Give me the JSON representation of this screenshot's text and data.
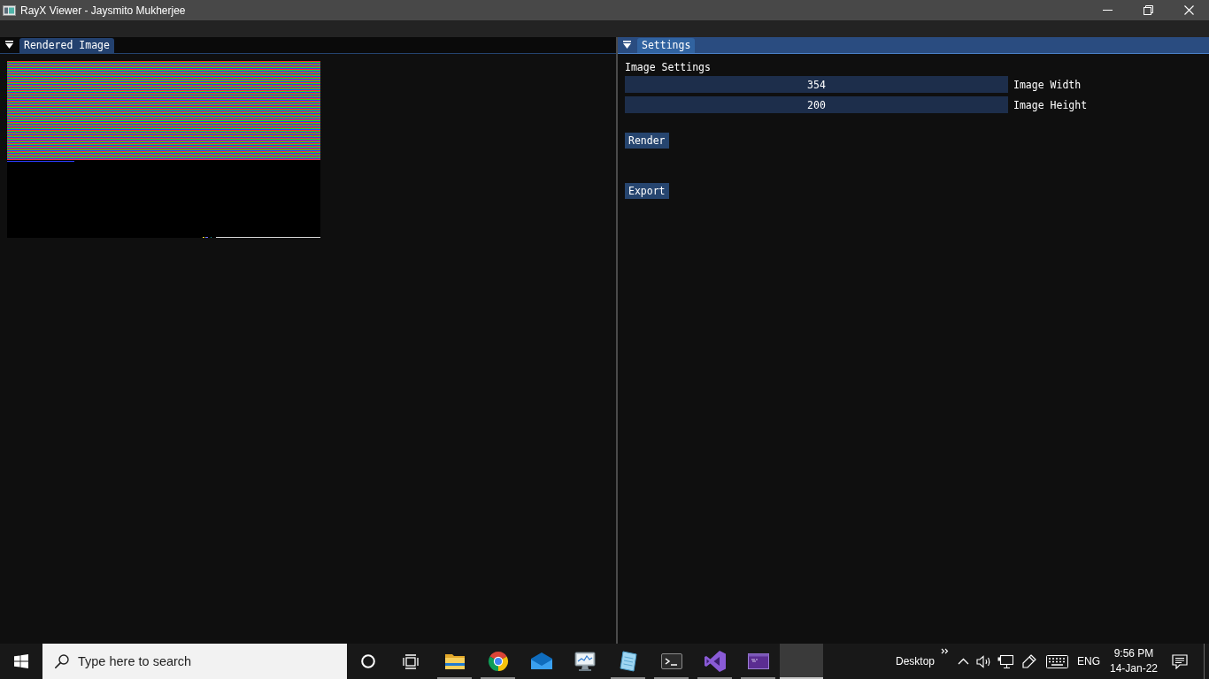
{
  "window": {
    "title": "RayX Viewer - Jaysmito Mukherjee"
  },
  "render_panel": {
    "tab": "Rendered Image",
    "focused": false
  },
  "settings_panel": {
    "tab": "Settings",
    "focused": true,
    "heading": "Image Settings",
    "fields": [
      {
        "value": "354",
        "label": "Image Width"
      },
      {
        "value": "200",
        "label": "Image Height"
      }
    ],
    "buttons": [
      {
        "label": "Render"
      },
      {
        "label": "Export"
      }
    ]
  },
  "taskbar": {
    "search": {
      "placeholder": "Type here to search"
    },
    "apps": [
      {
        "kind": "folder",
        "running": true,
        "selected": false
      },
      {
        "kind": "browser",
        "running": true,
        "selected": false
      },
      {
        "kind": "mail",
        "running": false,
        "selected": false
      },
      {
        "kind": "monitor",
        "running": false,
        "selected": false
      },
      {
        "kind": "notepad",
        "running": true,
        "selected": false
      },
      {
        "kind": "terminal",
        "running": true,
        "selected": false
      },
      {
        "kind": "studio",
        "running": true,
        "selected": false
      },
      {
        "kind": "console",
        "running": true,
        "selected": false
      },
      {
        "kind": "blank",
        "running": true,
        "selected": true
      }
    ],
    "tray": {
      "toolbar_label": "Desktop",
      "language": "ENG",
      "time": "9:56 PM",
      "date": "14-Jan-22"
    }
  }
}
